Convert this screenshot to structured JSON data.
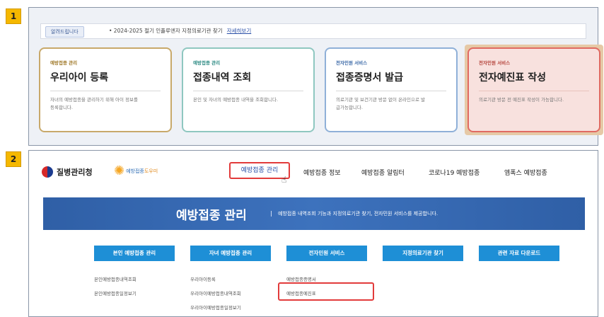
{
  "steps": [
    "1",
    "2"
  ],
  "notice": {
    "label": "알려드립니다",
    "text": "• 2024-2025 절기 인플루엔자 지정의료기관 찾기",
    "link": "자세히보기"
  },
  "service_cards": [
    {
      "category": "예방접종 관리",
      "title": "우리아이 등록",
      "desc": "자녀의 예방접종을 관리하기 위해 아이 정보를 등록합니다."
    },
    {
      "category": "예방접종 관리",
      "title": "접종내역 조회",
      "desc": "본인 및 자녀의 예방접종 내역을 조회합니다."
    },
    {
      "category": "전자민원 서비스",
      "title": "접종증명서 발급",
      "desc": "의료기관 및 보건기관 방문 없이 온라인으로 발급가능합니다."
    },
    {
      "category": "전자민원 서비스",
      "title": "전자예진표 작성",
      "desc": "의료기관 방문 전 예진표 작성이 가능합니다."
    }
  ],
  "logos": {
    "kdca": "질병관리청",
    "vaccine_left": "예방접종",
    "vaccine_right": "도우미"
  },
  "gnb": [
    "예방접종 관리",
    "예방접종 정보",
    "예방접종 알림터",
    "코로나19 예방접종",
    "엠폭스 예방접종"
  ],
  "hero": {
    "title": "예방접종 관리",
    "subtitle": "예방접종 내역조회 기능과 지정의료기관 찾기, 전자민원 서비스를 제공합니다."
  },
  "menu_buttons": [
    "본인 예방접종 관리",
    "자녀 예방접종 관리",
    "전자민원 서비스",
    "지정의료기관 찾기",
    "관련 자료 다운로드"
  ],
  "submenu": {
    "self": [
      "본인예방접종내역조회",
      "본인예방접종일정보기"
    ],
    "child": [
      "우리아이등록",
      "우리아이예방접종내역조회",
      "우리아이예방접종일정보기"
    ],
    "civil": [
      "예방접종증명서",
      "예방접종예진표"
    ]
  },
  "colors": {
    "badge": "#f5b800",
    "highlight": "#e23b3b",
    "hero": "#3366aa",
    "menu_button": "#1e8fd6"
  }
}
